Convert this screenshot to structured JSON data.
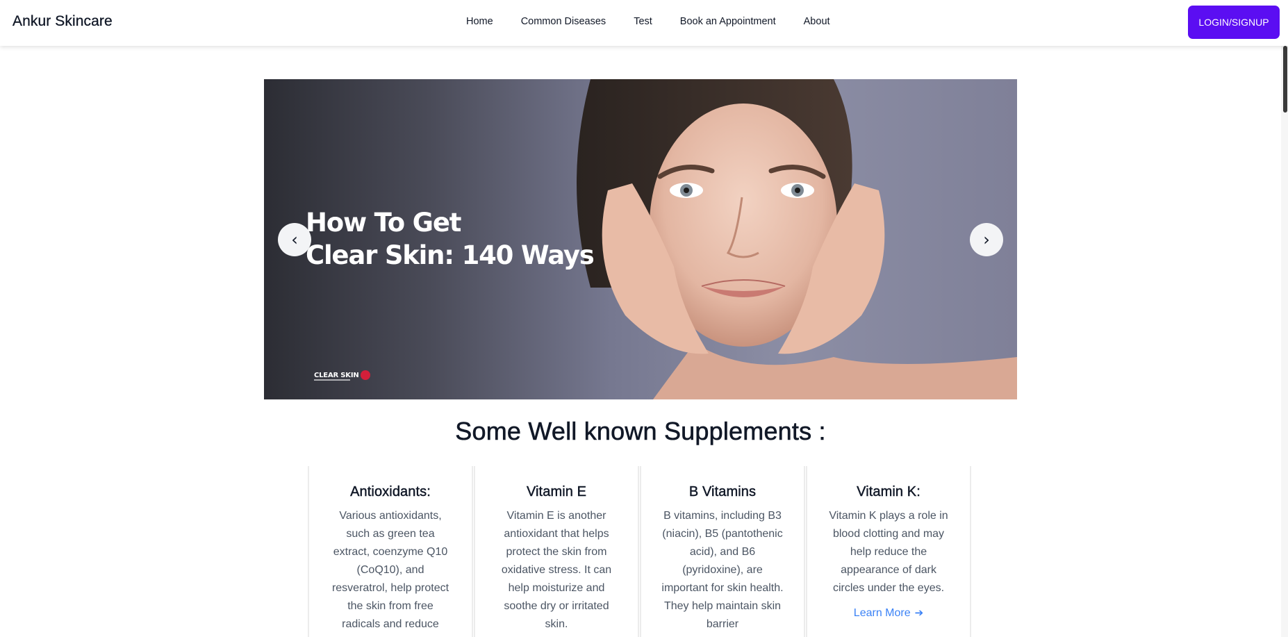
{
  "navbar": {
    "brand": "Ankur Skincare",
    "links": [
      "Home",
      "Common Diseases",
      "Test",
      "Book an Appointment",
      "About"
    ],
    "login_label": "LOGIN/SIGNUP"
  },
  "carousel": {
    "title_line1": "How To Get",
    "title_line2": "Clear Skin: 140 Ways",
    "logo_text": "CLEAR SKIN",
    "prev_label": "‹",
    "next_label": "›"
  },
  "supplements": {
    "heading": "Some Well known Supplements :",
    "cards": [
      {
        "title": "Antioxidants:",
        "text": "Various antioxidants, such as green tea extract, coenzyme Q10 (CoQ10), and resveratrol, help protect the skin from free radicals and reduce"
      },
      {
        "title": "Vitamin E",
        "text": "Vitamin E is another antioxidant that helps protect the skin from oxidative stress. It can help moisturize and soothe dry or irritated skin."
      },
      {
        "title": "B Vitamins",
        "text": "B vitamins, including B3 (niacin), B5 (pantothenic acid), and B6 (pyridoxine), are important for skin health. They help maintain skin barrier"
      },
      {
        "title": "Vitamin K:",
        "text": "Vitamin K plays a role in blood clotting and may help reduce the appearance of dark circles under the eyes.",
        "link": "Learn More"
      }
    ]
  },
  "colors": {
    "accent": "#5b0ef2",
    "link": "#3b82f6"
  }
}
